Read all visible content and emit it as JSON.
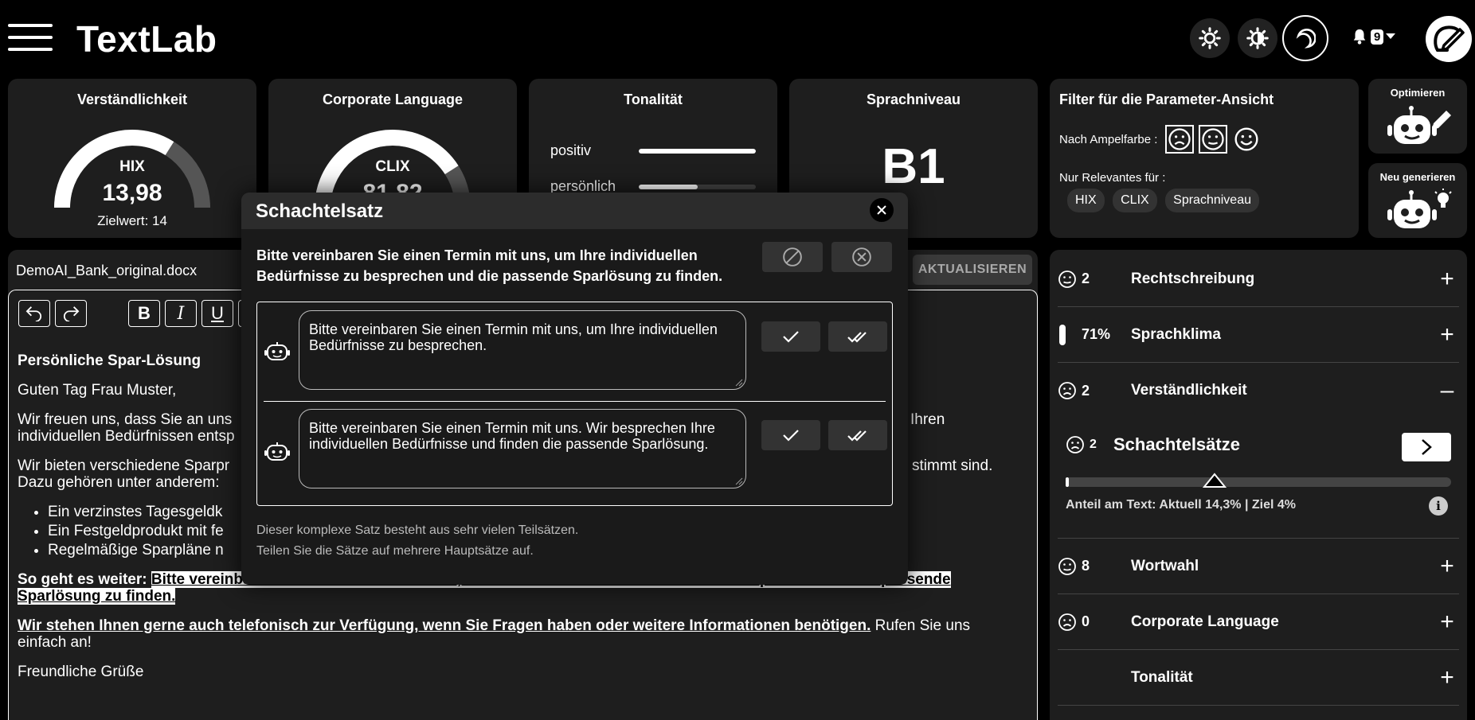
{
  "header": {
    "app_title": "TextLab",
    "notification_count": "9"
  },
  "metrics": {
    "hix": {
      "title": "Verständlichkeit",
      "label": "HIX",
      "value": "13,98",
      "target": "Zielwert: 14",
      "level": 0.68
    },
    "clix": {
      "title": "Corporate Language",
      "label": "CLIX",
      "value": "81,82",
      "level": 0.82
    },
    "tone": {
      "title": "Tonalität",
      "rows": [
        {
          "label": "positiv",
          "level": 1.0
        },
        {
          "label": "persönlich",
          "level": 0.5
        }
      ]
    },
    "level": {
      "title": "Sprachniveau",
      "value": "B1"
    }
  },
  "filter": {
    "title": "Filter für die Parameter-Ansicht",
    "ampel_label": "Nach Ampelfarbe :",
    "relevant_label": "Nur Relevantes für :",
    "chips": [
      "HIX",
      "CLIX",
      "Sprachniveau"
    ]
  },
  "side_actions": {
    "optimize": "Optimieren",
    "regenerate": "Neu generieren"
  },
  "document": {
    "filename": "DemoAI_Bank_original.docx",
    "update_label": "AKTUALISIEREN",
    "heading": "Persönliche Spar-Lösung",
    "greeting": "Guten Tag Frau Muster,",
    "p1_start": "Wir freuen uns, dass Sie an uns",
    "p1_end": "Ihren",
    "p1_line2": "individuellen Bedürfnissen entsp",
    "p2_start": "Wir bieten verschiedene Sparpr",
    "p2_end": "stimmt sind.",
    "p2_line2": "Dazu gehören unter anderem:",
    "list": [
      "Ein verzinstes Tagesgeldk",
      "Ein Festgeldprodukt mit fe",
      "Regelmäßige Sparpläne n"
    ],
    "next_label": "So geht es weiter:",
    "next_highlight": "Bitte vereinbaren Sie einen Termin mit uns, um Ihre individuellen Bedürfnisse zu besprechen und die passende Sparlösung zu finden.",
    "phone_underlined": "Wir stehen Ihnen gerne auch telefonisch zur Verfügung, wenn Sie Fragen haben oder weitere Informationen benötigen.",
    "phone_rest": "Rufen Sie uns einfach an!",
    "closing": "Freundliche Grüße"
  },
  "right_panel": {
    "rows": [
      {
        "count": "2",
        "label": "Rechtschreibung",
        "toggle": "+"
      },
      {
        "count": "71%",
        "label": "Sprachklima",
        "toggle": "+"
      },
      {
        "count": "2",
        "label": "Verständlichkeit",
        "toggle": "–"
      }
    ],
    "sub": {
      "count": "2",
      "title": "Schachtelsätze",
      "info": "Anteil am Text: Aktuell 14,3% | Ziel 4%",
      "info_icon": "i",
      "current": 0.143,
      "target": 0.04
    },
    "rows_after": [
      {
        "count": "8",
        "label": "Wortwahl",
        "toggle": "+"
      },
      {
        "count": "0",
        "label": "Corporate Language",
        "toggle": "+"
      },
      {
        "count": "",
        "label": "Tonalität",
        "toggle": "+"
      }
    ]
  },
  "modal": {
    "title": "Schachtelsatz",
    "sentence": "Bitte vereinbaren Sie einen Termin mit uns, um Ihre individuellen Bedürfnisse zu besprechen und die passende Sparlösung zu finden.",
    "suggestions": [
      "Bitte vereinbaren Sie einen Termin mit uns, um Ihre individuellen Bedürfnisse zu besprechen.",
      "Bitte vereinbaren Sie einen Termin mit uns. Wir besprechen Ihre individuellen Bedürfnisse und finden die passende Sparlösung."
    ],
    "hint_line1": "Dieser komplexe Satz besteht aus sehr vielen Teilsätzen.",
    "hint_line2": "Teilen Sie die Sätze auf mehrere Hauptsätze auf."
  }
}
